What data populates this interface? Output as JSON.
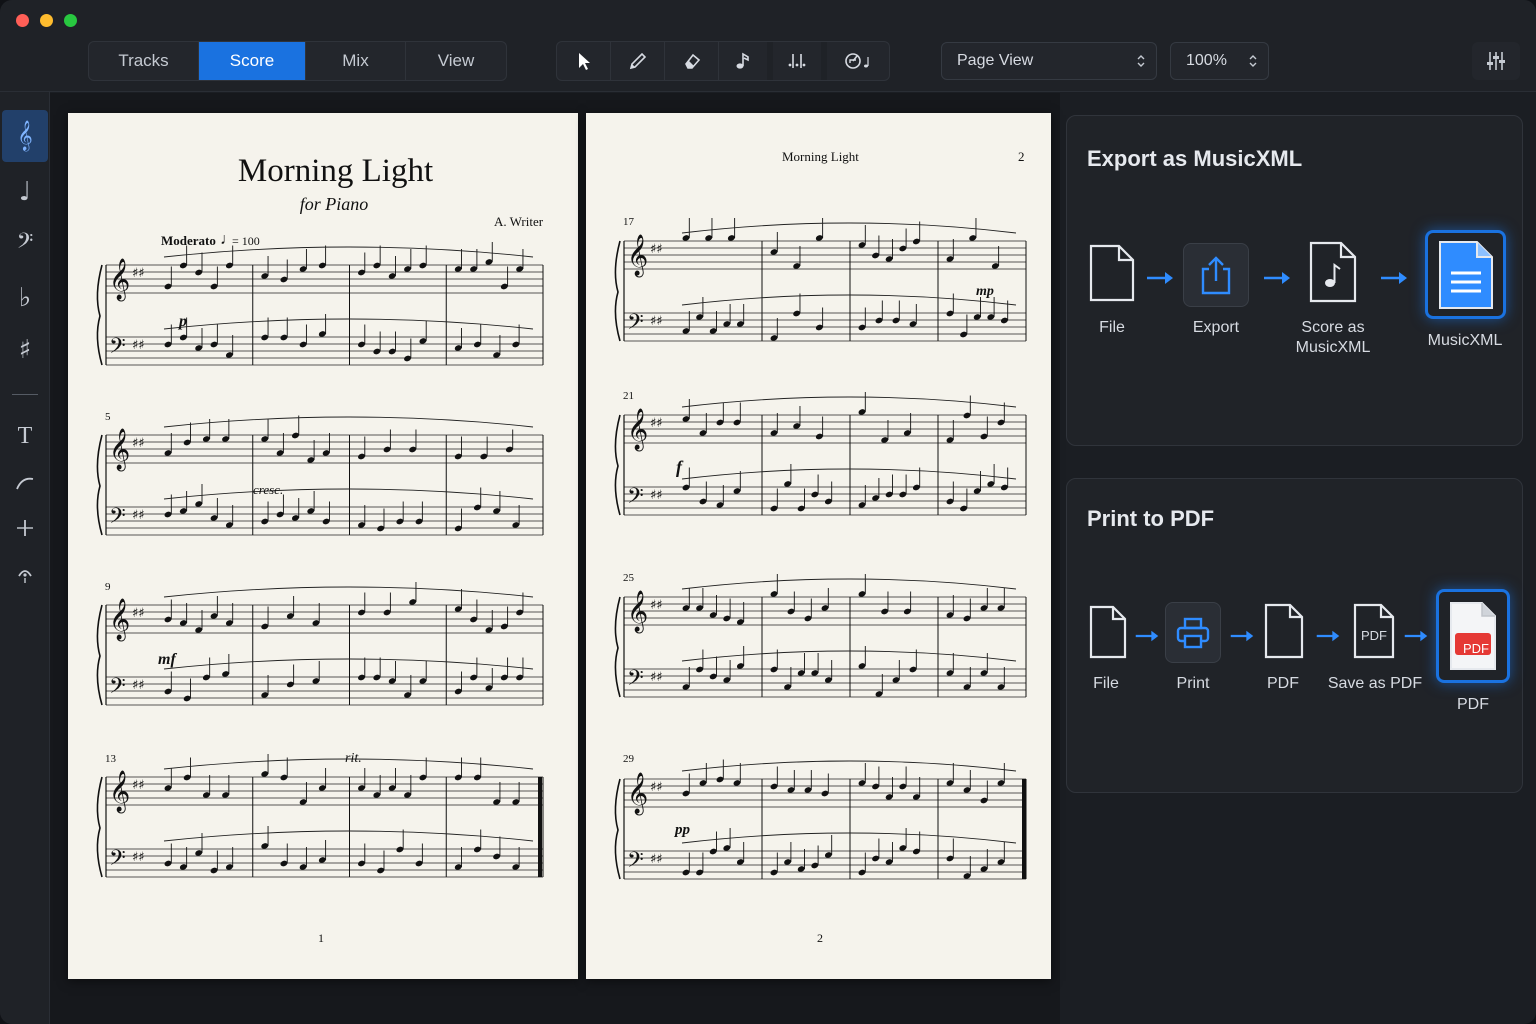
{
  "toolbar": {
    "tabs": [
      {
        "label": "Tracks",
        "active": false
      },
      {
        "label": "Score",
        "active": true
      },
      {
        "label": "Mix",
        "active": false
      },
      {
        "label": "View",
        "active": false
      }
    ],
    "tools": [
      "select-arrow",
      "pencil",
      "eraser",
      "note",
      "beat-split",
      "metronome"
    ],
    "view_select": "Page View",
    "zoom_select": "100%"
  },
  "sidebar": {
    "items": [
      "treble-clef",
      "quarter-note",
      "bass-clef",
      "flat",
      "sharp",
      "text",
      "slur",
      "barline",
      "fermata"
    ],
    "glyphs": {
      "treble": "𝄞",
      "note": "♩",
      "bass": "𝄢",
      "flat": "♭",
      "sharp": "♯",
      "text": "T"
    }
  },
  "score": {
    "title": "Morning Light",
    "subtitle": "for Piano",
    "composer": "A. Writer",
    "tempo_marking": "Moderato",
    "tempo_value": "= 100",
    "running_title": "Morning Light",
    "page_numbers": [
      "1",
      "2"
    ],
    "page2_header_number": "2",
    "measure_numbers_p1": [
      "5",
      "9",
      "13"
    ],
    "measure_numbers_p2": [
      "17",
      "21",
      "25",
      "29"
    ],
    "dynamics": {
      "p": "p",
      "cresc": "cresc.",
      "mf": "mf",
      "rit": "rit.",
      "mp": "mp",
      "f": "f",
      "pp": "pp"
    }
  },
  "export_panel": {
    "title": "Export as MusicXML",
    "steps": [
      "File",
      "Export",
      "Score as MusicXML",
      "MusicXML"
    ]
  },
  "pdf_panel": {
    "title": "Print to PDF",
    "steps": [
      "File",
      "Print",
      "PDF",
      "Save as PDF",
      "PDF"
    ],
    "pdf_badge": "PDF"
  },
  "colors": {
    "accent": "#1a72e0",
    "paper": "#f5f3ec",
    "badge_red": "#e53935"
  }
}
